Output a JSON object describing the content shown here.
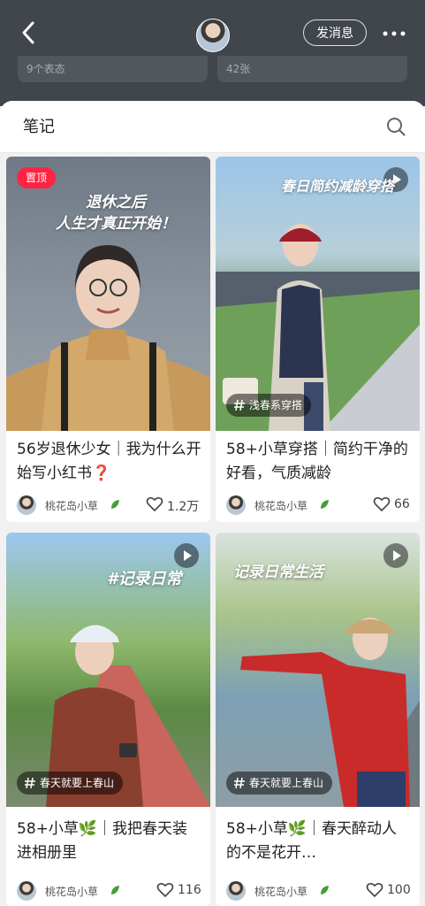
{
  "header": {
    "send_message_label": "发消息",
    "stats": [
      "9个表态",
      "42张"
    ],
    "icons": [
      "back-icon",
      "profile-avatar",
      "more-icon"
    ]
  },
  "section": {
    "title": "笔记",
    "search_icon": "search-icon"
  },
  "notes": [
    {
      "caption": "56岁退休少女｜我为什么开始写小红书❓",
      "overlay": "退休之后\n人生才真正开始！",
      "pin": "置顶",
      "tag": "",
      "author": "桃花岛小草",
      "likes": "1.2万",
      "video": false
    },
    {
      "caption": "58+小草穿搭｜简约干净的好看，气质减龄",
      "overlay": "春日简约减龄穿搭",
      "pin": "",
      "tag": "浅春系穿搭",
      "author": "桃花岛小草",
      "likes": "66",
      "video": true
    },
    {
      "caption": "58+小草🌿｜我把春天装进相册里",
      "overlay": "#记录日常",
      "pin": "",
      "tag": "春天就要上春山",
      "author": "桃花岛小草",
      "likes": "116",
      "video": true
    },
    {
      "caption": "58+小草🌿｜春天醉动人的不是花开…",
      "overlay": "记录日常生活",
      "pin": "",
      "tag": "春天就要上春山",
      "author": "桃花岛小草",
      "likes": "100",
      "video": true
    }
  ],
  "colors": {
    "accent": "#ff2442",
    "topbar": "#40464b",
    "background": "#f1f1f1"
  }
}
